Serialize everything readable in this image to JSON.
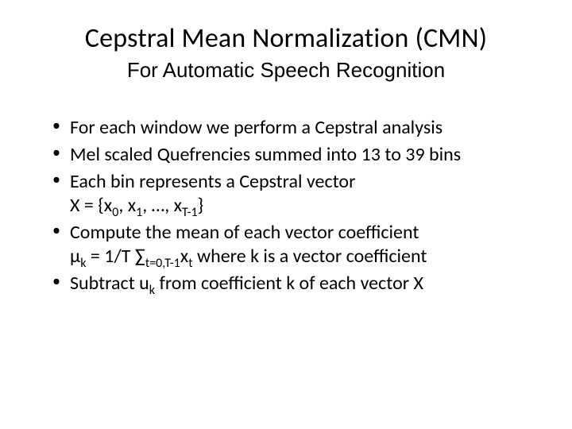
{
  "title": "Cepstral Mean Normalization (CMN)",
  "subtitle": "For Automatic Speech Recognition",
  "bullets": {
    "b0": "For each window we perform a Cepstral analysis",
    "b1": "Mel scaled Quefrencies summed into 13 to 39 bins",
    "b2": {
      "line1": "Each bin represents a Cepstral vector",
      "x_eq_prefix": "X = {x",
      "s0": "0",
      "sep1": ", x",
      "s1": "1",
      "sep2": ", …, x",
      "sT": "T-1",
      "close": "}"
    },
    "b3": {
      "line1": "Compute the mean of each vector coefficient",
      "mu": "μ",
      "k1": "k",
      "eq": " = 1/T ∑",
      "sumsub": "t=0,T-1",
      "xt_x": "x",
      "xt_t": "t",
      "tail": " where k is a vector coefficient"
    },
    "b4": {
      "pre": "Subtract u",
      "k": "k",
      "post": " from coefficient k of each vector X"
    }
  }
}
